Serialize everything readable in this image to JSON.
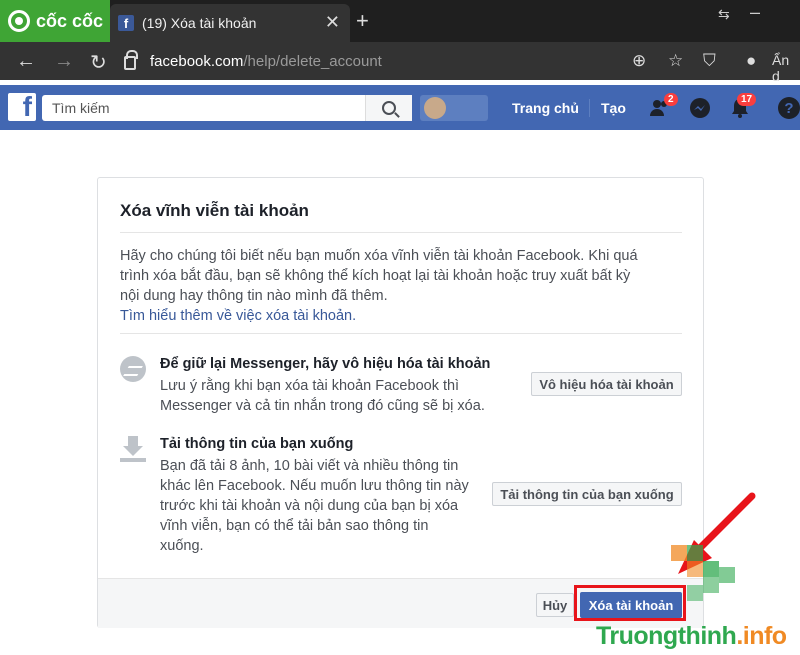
{
  "browser": {
    "brand": "cốc cốc",
    "tab_title": "(19) Xóa tài khoản",
    "tab_favicon": "f",
    "url_host": "facebook.com",
    "url_path": "/help/delete_account",
    "side_label": "Ẩn d"
  },
  "fb": {
    "logo": "f",
    "search_placeholder": "Tìm kiếm",
    "nav_home": "Trang chủ",
    "nav_create": "Tạo",
    "badge_friends": "2",
    "badge_notifications": "17",
    "help": "?"
  },
  "dialog": {
    "title": "Xóa vĩnh viễn tài khoản",
    "intro_line1": "Hãy cho chúng tôi biết nếu bạn muốn xóa vĩnh viễn tài khoản Facebook. Khi quá",
    "intro_line2": "trình xóa bắt đầu, bạn sẽ không thể kích hoạt lại tài khoản hoặc truy xuất bất kỳ",
    "intro_line3": "nội dung hay thông tin nào mình đã thêm.",
    "learn_more": "Tìm hiểu thêm về việc xóa tài khoản.",
    "messenger": {
      "title": "Để giữ lại Messenger, hãy vô hiệu hóa tài khoản",
      "line1": "Lưu ý rằng khi bạn xóa tài khoản Facebook thì",
      "line2": "Messenger và cả tin nhắn trong đó cũng sẽ bị xóa.",
      "button": "Vô hiệu hóa tài khoản"
    },
    "download": {
      "title": "Tải thông tin của bạn xuống",
      "line1": "Bạn đã tải 8 ảnh, 10 bài viết và nhiều thông tin",
      "line2": "khác lên Facebook. Nếu muốn lưu thông tin này",
      "line3": "trước khi tài khoản và nội dung của bạn bị xóa",
      "line4": "vĩnh viễn, bạn có thể tải bản sao thông tin",
      "line5": "xuống.",
      "button": "Tải thông tin của bạn xuống"
    },
    "cancel": "Hủy",
    "delete": "Xóa tài khoản"
  },
  "watermark": {
    "part1": "Truong",
    "part2": "thinh",
    "part3": ".info"
  },
  "colors": {
    "fb_blue": "#4267b2",
    "highlight_red": "#e8141a"
  }
}
